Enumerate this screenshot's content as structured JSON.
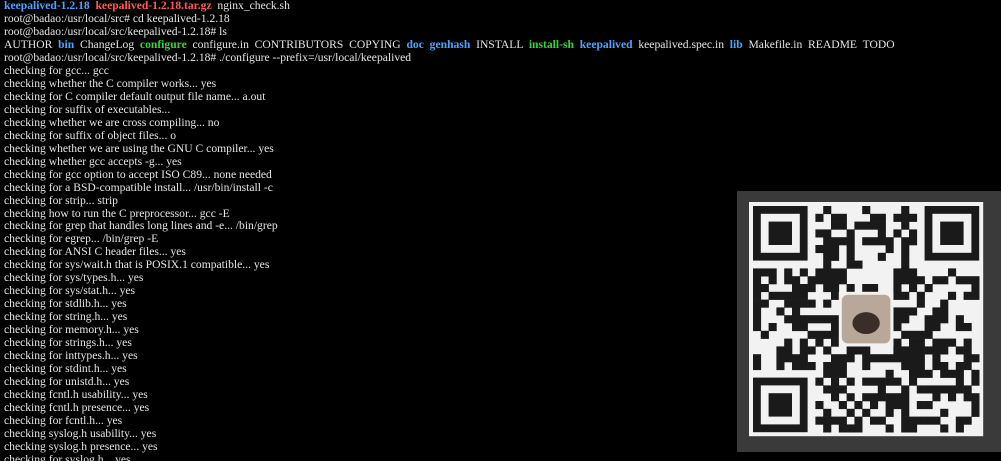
{
  "terminal": {
    "lines": [
      [
        {
          "text": "keepalived-1.2.18",
          "color": "blue"
        },
        {
          "text": "  ",
          "color": "white"
        },
        {
          "text": "keepalived-1.2.18.tar.gz",
          "color": "red"
        },
        {
          "text": "  nginx_check.sh",
          "color": "white"
        }
      ],
      [
        {
          "text": "root@badao:/usr/local/src# cd keepalived-1.2.18",
          "color": "white"
        }
      ],
      [
        {
          "text": "root@badao:/usr/local/src/keepalived-1.2.18# ls",
          "color": "white"
        }
      ],
      [
        {
          "text": "AUTHOR  ",
          "color": "white"
        },
        {
          "text": "bin",
          "color": "blue"
        },
        {
          "text": "  ChangeLog  ",
          "color": "white"
        },
        {
          "text": "configure",
          "color": "green"
        },
        {
          "text": "  configure.in  CONTRIBUTORS  COPYING  ",
          "color": "white"
        },
        {
          "text": "doc",
          "color": "blue"
        },
        {
          "text": "  ",
          "color": "white"
        },
        {
          "text": "genhash",
          "color": "blue"
        },
        {
          "text": "  INSTALL  ",
          "color": "white"
        },
        {
          "text": "install-sh",
          "color": "green"
        },
        {
          "text": "  ",
          "color": "white"
        },
        {
          "text": "keepalived",
          "color": "blue"
        },
        {
          "text": "  keepalived.spec.in  ",
          "color": "white"
        },
        {
          "text": "lib",
          "color": "blue"
        },
        {
          "text": "  Makefile.in  README  TODO",
          "color": "white"
        }
      ],
      [
        {
          "text": "root@badao:/usr/local/src/keepalived-1.2.18# ./configure --prefix=/usr/local/keepalived",
          "color": "white"
        }
      ],
      [
        {
          "text": "checking for gcc... gcc",
          "color": "white"
        }
      ],
      [
        {
          "text": "checking whether the C compiler works... yes",
          "color": "white"
        }
      ],
      [
        {
          "text": "checking for C compiler default output file name... a.out",
          "color": "white"
        }
      ],
      [
        {
          "text": "checking for suffix of executables...",
          "color": "white"
        }
      ],
      [
        {
          "text": "checking whether we are cross compiling... no",
          "color": "white"
        }
      ],
      [
        {
          "text": "checking for suffix of object files... o",
          "color": "white"
        }
      ],
      [
        {
          "text": "checking whether we are using the GNU C compiler... yes",
          "color": "white"
        }
      ],
      [
        {
          "text": "checking whether gcc accepts -g... yes",
          "color": "white"
        }
      ],
      [
        {
          "text": "checking for gcc option to accept ISO C89... none needed",
          "color": "white"
        }
      ],
      [
        {
          "text": "checking for a BSD-compatible install... /usr/bin/install -c",
          "color": "white"
        }
      ],
      [
        {
          "text": "checking for strip... strip",
          "color": "white"
        }
      ],
      [
        {
          "text": "checking how to run the C preprocessor... gcc -E",
          "color": "white"
        }
      ],
      [
        {
          "text": "checking for grep that handles long lines and -e... /bin/grep",
          "color": "white"
        }
      ],
      [
        {
          "text": "checking for egrep... /bin/grep -E",
          "color": "white"
        }
      ],
      [
        {
          "text": "checking for ANSI C header files... yes",
          "color": "white"
        }
      ],
      [
        {
          "text": "checking for sys/wait.h that is POSIX.1 compatible... yes",
          "color": "white"
        }
      ],
      [
        {
          "text": "checking for sys/types.h... yes",
          "color": "white"
        }
      ],
      [
        {
          "text": "checking for sys/stat.h... yes",
          "color": "white"
        }
      ],
      [
        {
          "text": "checking for stdlib.h... yes",
          "color": "white"
        }
      ],
      [
        {
          "text": "checking for string.h... yes",
          "color": "white"
        }
      ],
      [
        {
          "text": "checking for memory.h... yes",
          "color": "white"
        }
      ],
      [
        {
          "text": "checking for strings.h... yes",
          "color": "white"
        }
      ],
      [
        {
          "text": "checking for inttypes.h... yes",
          "color": "white"
        }
      ],
      [
        {
          "text": "checking for stdint.h... yes",
          "color": "white"
        }
      ],
      [
        {
          "text": "checking for unistd.h... yes",
          "color": "white"
        }
      ],
      [
        {
          "text": "checking fcntl.h usability... yes",
          "color": "white"
        }
      ],
      [
        {
          "text": "checking fcntl.h presence... yes",
          "color": "white"
        }
      ],
      [
        {
          "text": "checking for fcntl.h... yes",
          "color": "white"
        }
      ],
      [
        {
          "text": "checking syslog.h usability... yes",
          "color": "white"
        }
      ],
      [
        {
          "text": "checking syslog.h presence... yes",
          "color": "white"
        }
      ],
      [
        {
          "text": "checking for syslog.h... yes",
          "color": "white"
        }
      ]
    ]
  },
  "colors": {
    "background": "#000000",
    "text": "#e6e6e6",
    "directory_blue": "#4fa3ff",
    "archive_red": "#ff5a5a",
    "executable_green": "#3bd23b",
    "qr_panel": "#3a3a3a"
  },
  "qr_overlay": {
    "icon": "qr-code-icon",
    "center_icon": "pug-avatar-icon"
  }
}
